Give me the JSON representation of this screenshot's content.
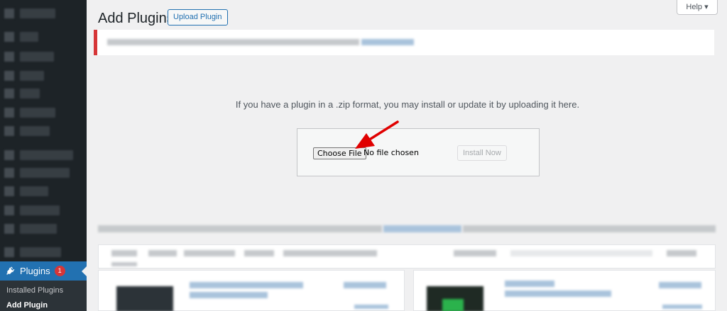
{
  "sidebar": {
    "plugins_label": "Plugins",
    "plugins_badge": "1",
    "installed_plugins": "Installed Plugins",
    "add_plugin": "Add Plugin"
  },
  "header": {
    "title": "Add Plugins",
    "upload_button": "Upload Plugin",
    "help_button": "Help ▾"
  },
  "upload": {
    "instructions": "If you have a plugin in a .zip format, you may install or update it by uploading it here.",
    "choose_file_button": "Choose File",
    "file_status": "No file chosen",
    "install_button": "Install Now"
  },
  "colors": {
    "sidebar_bg": "#1d2327",
    "accent": "#2271b1",
    "badge": "#d63638",
    "arrow": "#e00000"
  },
  "icons": {
    "plugins": "plug-icon"
  }
}
